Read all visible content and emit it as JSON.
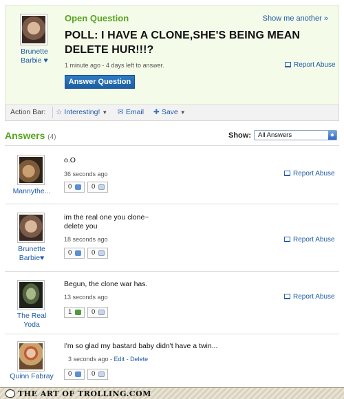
{
  "question": {
    "status": "Open Question",
    "show_another": "Show me another »",
    "title": "POLL: I HAVE A CLONE,SHE'S BEING MEAN DELETE HUR!!!?",
    "meta": "1 minute ago - 4 days left to answer.",
    "report_abuse": "Report Abuse",
    "answer_button": "Answer Question",
    "asker": {
      "name": "Brunette Barbie ♥"
    }
  },
  "action_bar": {
    "label": "Action Bar:",
    "interesting": "Interesting!",
    "email": "Email",
    "save": "Save"
  },
  "answers_section": {
    "title": "Answers",
    "count": "(4)",
    "show_label": "Show:",
    "show_selected": "All Answers"
  },
  "answers": [
    {
      "user": "Mannythe...",
      "text": "o.O",
      "time": "36 seconds ago",
      "report": "Report Abuse",
      "up": "0",
      "down": "0"
    },
    {
      "user": "Brunette Barbie♥",
      "text": "im the real one you clone~\ndelete you",
      "time": "18 seconds ago",
      "report": "Report Abuse",
      "up": "0",
      "down": "0"
    },
    {
      "user": "The Real Yoda",
      "text": "Begun, the clone war has.",
      "time": "13 seconds ago",
      "report": "Report Abuse",
      "up": "1",
      "down": "0"
    },
    {
      "user": "Quinn Fabray",
      "text": "I'm so glad my bastard baby didn't have a twin...",
      "time": "3 seconds ago",
      "edit": "Edit",
      "delete": "Delete",
      "up": "0",
      "down": "0"
    }
  ],
  "footer": {
    "brand": "THE ART OF TROLLING.COM"
  },
  "colors": {
    "accent_green": "#57a41f",
    "link_blue": "#1f5aa8",
    "button_blue": "#2f7cc4"
  }
}
